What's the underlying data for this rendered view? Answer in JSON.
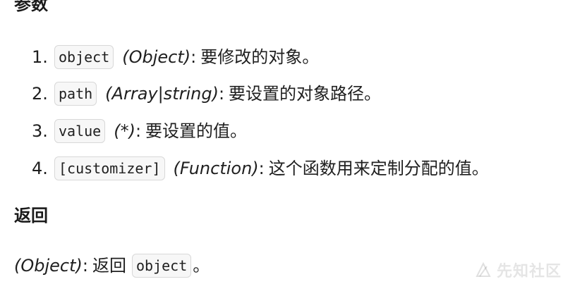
{
  "sections": {
    "params_heading": "参数",
    "returns_heading": "返回"
  },
  "params": [
    {
      "num": "1.",
      "code": "object",
      "type": "(Object)",
      "colon": ":",
      "desc": "要修改的对象。"
    },
    {
      "num": "2.",
      "code": "path",
      "type": "(Array|string)",
      "colon": ":",
      "desc": "要设置的对象路径。"
    },
    {
      "num": "3.",
      "code": "value",
      "type": "(*)",
      "colon": ":",
      "desc": "要设置的值。"
    },
    {
      "num": "4.",
      "code": "[customizer]",
      "type": "(Function)",
      "colon": ":",
      "desc": "这个函数用来定制分配的值。"
    }
  ],
  "returns": {
    "type": "(Object)",
    "colon": ":",
    "desc": "返回",
    "code": "object",
    "end": "。"
  },
  "watermark": {
    "text": "先知社区"
  }
}
